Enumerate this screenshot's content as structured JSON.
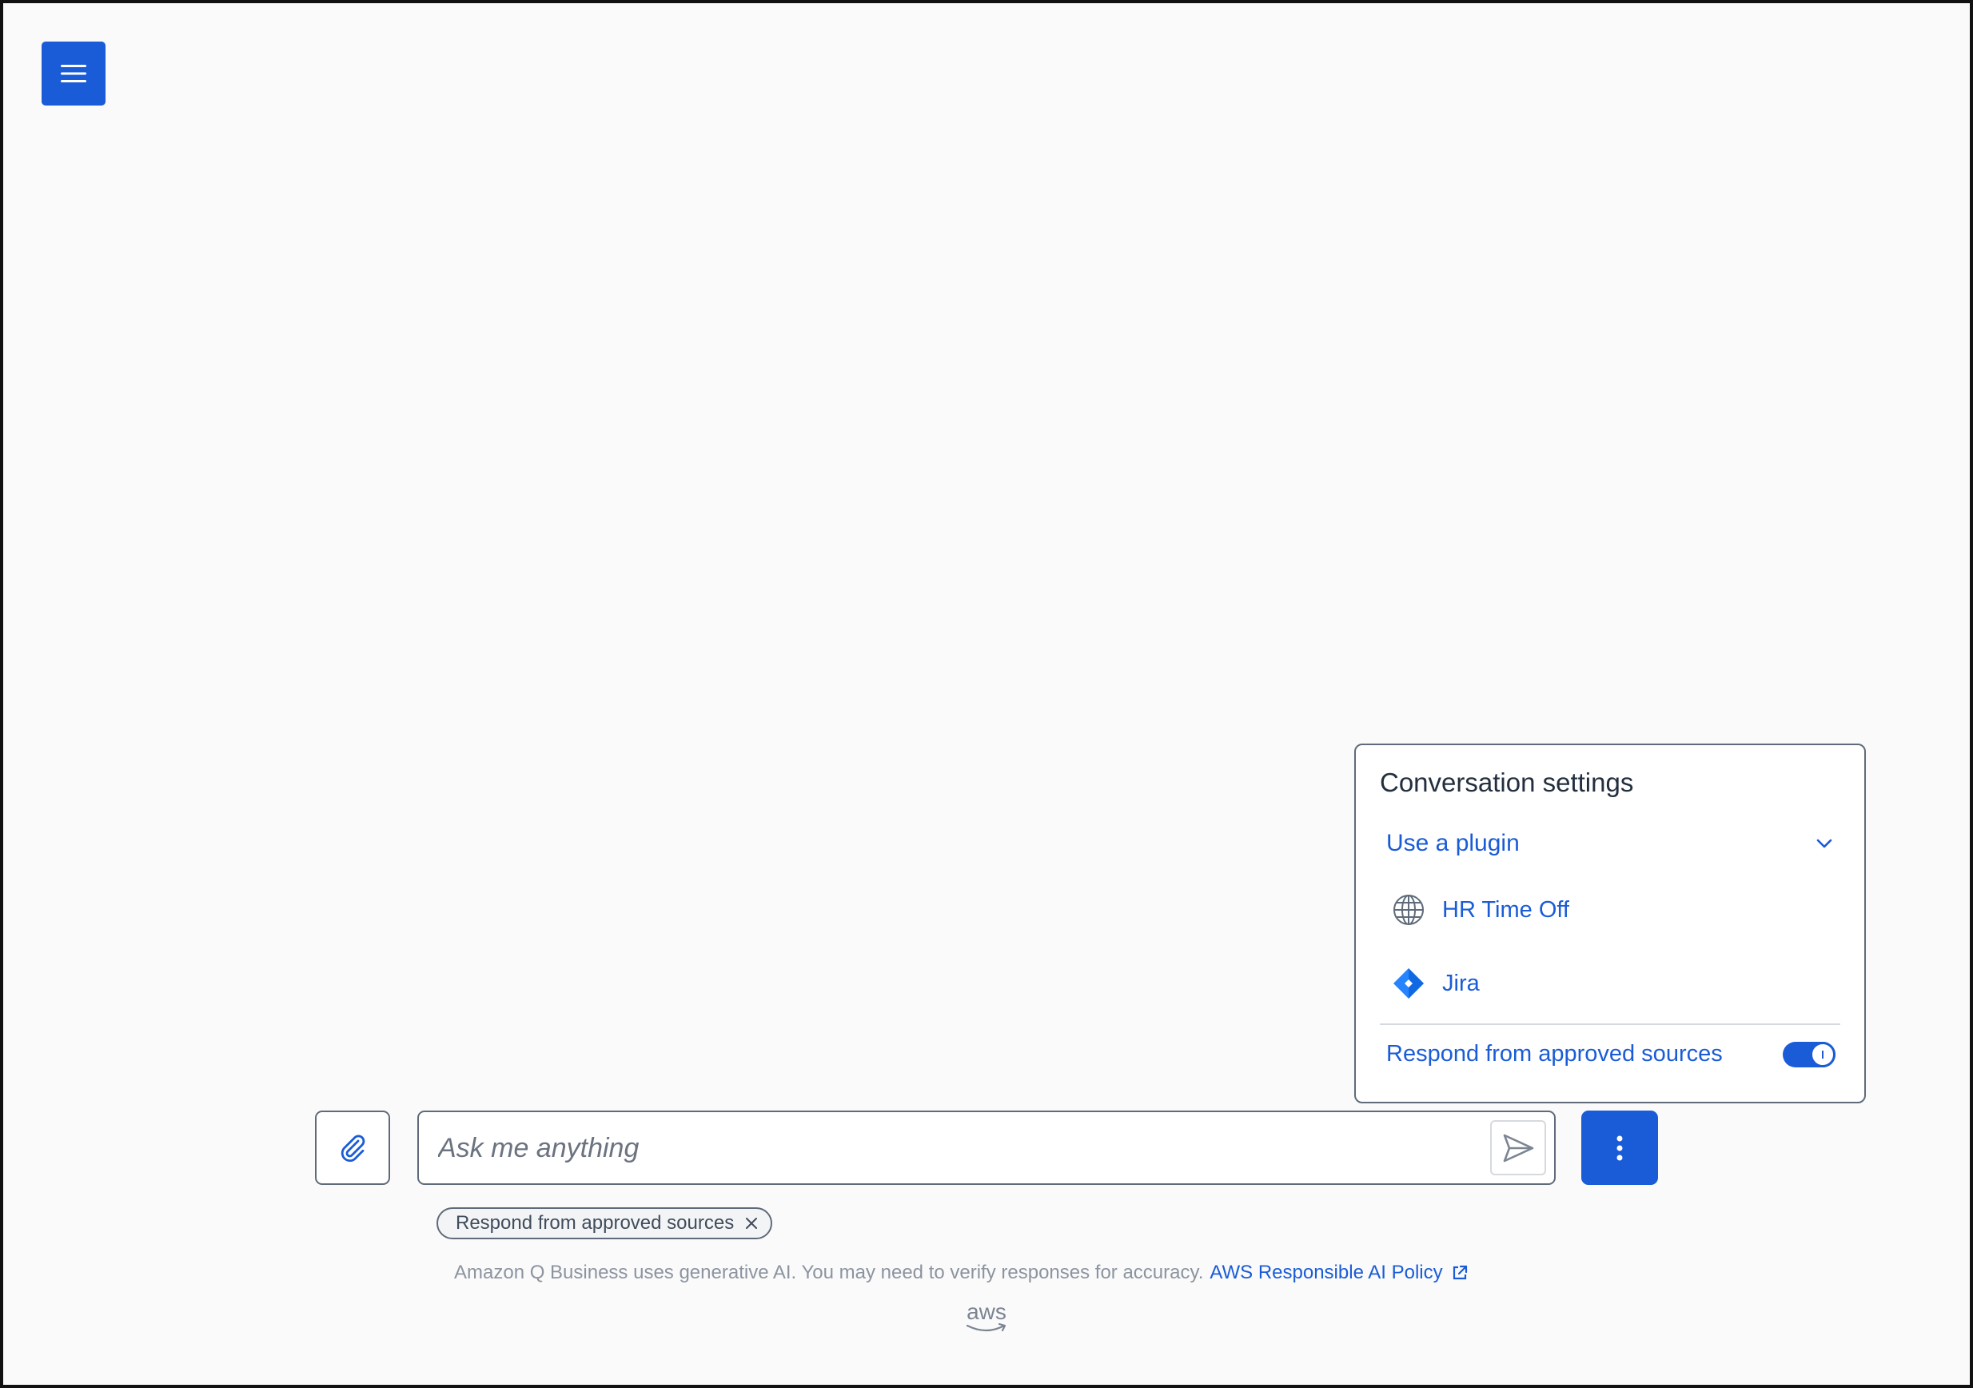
{
  "header": {
    "menu_icon": "hamburger-menu-icon"
  },
  "composer": {
    "attach_icon": "paperclip-icon",
    "input_placeholder": "Ask me anything",
    "input_value": "",
    "send_icon": "send-icon",
    "more_icon": "vertical-ellipsis-icon"
  },
  "tokens": [
    {
      "label": "Respond from approved sources",
      "dismiss_icon": "close-icon"
    }
  ],
  "footer": {
    "disclaimer": "Amazon Q Business uses generative AI. You may need to verify responses for accuracy.",
    "policy_link": "AWS Responsible AI Policy",
    "logo_text": "aws"
  },
  "settings_panel": {
    "title": "Conversation settings",
    "plugin_header": "Use a plugin",
    "plugins": [
      {
        "label": "HR Time Off",
        "icon": "globe-icon"
      },
      {
        "label": "Jira",
        "icon": "jira-icon"
      }
    ],
    "approved_sources_label": "Respond from approved sources",
    "approved_sources_enabled": true
  },
  "colors": {
    "accent": "#1a5cd7",
    "border": "#5f6b7a",
    "background": "#fafafa",
    "muted_text": "#8c94a0"
  }
}
